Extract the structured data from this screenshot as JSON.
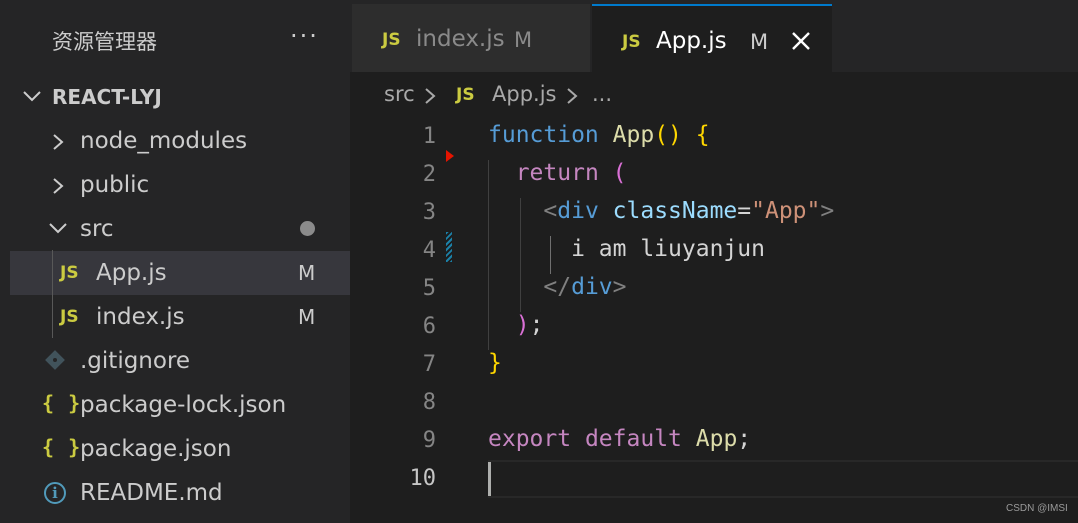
{
  "sidebar": {
    "title": "资源管理器",
    "more_label": "···",
    "root_label": "REACT-LYJ",
    "items": [
      {
        "label": "node_modules",
        "icon": "chevron-right-icon"
      },
      {
        "label": "public",
        "icon": "chevron-right-icon"
      },
      {
        "label": "src",
        "icon": "chevron-down-icon"
      },
      {
        "label": "App.js",
        "badge": "JS",
        "status": "M"
      },
      {
        "label": "index.js",
        "badge": "JS",
        "status": "M"
      },
      {
        "label": ".gitignore",
        "icon": "git-icon"
      },
      {
        "label": "package-lock.json",
        "badge": "{ }"
      },
      {
        "label": "package.json",
        "badge": "{ }"
      },
      {
        "label": "README.md",
        "icon": "info-icon",
        "badge": "i"
      }
    ]
  },
  "tabs": [
    {
      "badge": "JS",
      "label": "index.js",
      "status": "M",
      "active": false
    },
    {
      "badge": "JS",
      "label": "App.js",
      "status": "M",
      "active": true
    }
  ],
  "breadcrumb": {
    "folder": "src",
    "badge": "JS",
    "file": "App.js",
    "ellipsis": "..."
  },
  "editor": {
    "line_numbers": [
      "1",
      "2",
      "3",
      "4",
      "5",
      "6",
      "7",
      "8",
      "9",
      "10"
    ],
    "current_line": "10",
    "tokens": {
      "l1_function": "function",
      "l1_name": "App",
      "l1_parens": "()",
      "l1_brace": "{",
      "l2_return": "return",
      "l2_paren": "(",
      "l3_lt": "<",
      "l3_tag": "div",
      "l3_attr": "className",
      "l3_eq": "=",
      "l3_str": "\"App\"",
      "l3_gt": ">",
      "l4_text": "i am liuyanjun",
      "l5_lt": "</",
      "l5_tag": "div",
      "l5_gt": ">",
      "l6_paren": ")",
      "l6_semi": ";",
      "l7_brace": "}",
      "l9_export": "export",
      "l9_default": "default",
      "l9_name": "App",
      "l9_semi": ";"
    }
  },
  "watermark": "CSDN @IMSI",
  "colors": {
    "keyword": "#569cd6",
    "control": "#c586c0",
    "function": "#dcdcaa",
    "string": "#ce9178",
    "attribute": "#9cdcfe",
    "js_badge": "#cbcb41",
    "active_tab_border": "#007acc"
  }
}
